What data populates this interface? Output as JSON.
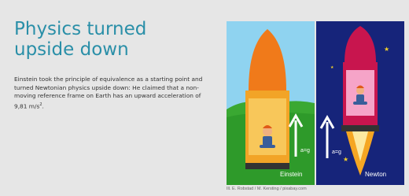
{
  "slide": {
    "title": "Physics turned upside down",
    "body_prefix": "Einstein took the principle of equivalence as a starting point and turned Newtonian physics upside down: He claimed that a non-moving reference frame on Earth has an upward acceleration of 9,81 m/s",
    "body_sup": "2",
    "body_suffix": "."
  },
  "illustration": {
    "left_panel": {
      "caption": "Einstein",
      "arrow_label": "a=g",
      "background_color": "#8fd3f0"
    },
    "right_panel": {
      "caption": "Newton",
      "arrow_label": "a=g",
      "background_color": "#16247a"
    },
    "credit": "Ill. E. Robstad / M. Kersting / pixabay.com"
  },
  "colors": {
    "title": "#2a8fa8",
    "rocket_left": "#f07a1a",
    "rocket_right": "#c8154e",
    "grass": "#3aa832"
  }
}
